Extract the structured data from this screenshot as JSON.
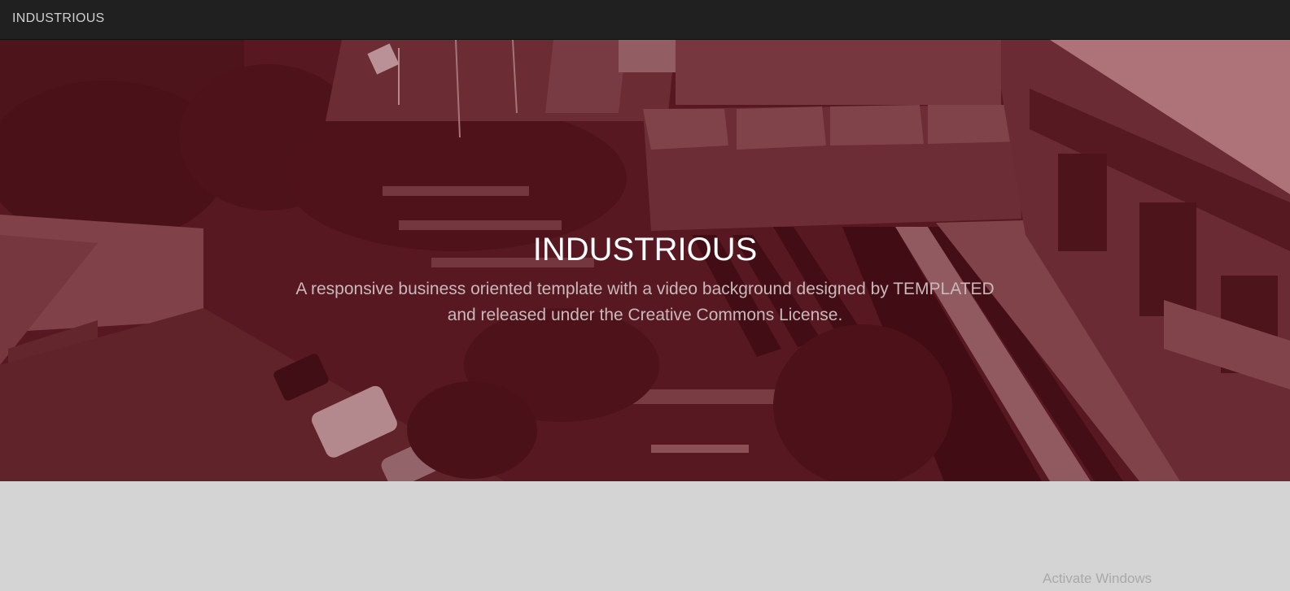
{
  "header": {
    "brand": "INDUSTRIOUS"
  },
  "hero": {
    "title": "INDUSTRIOUS",
    "subtitle": "A responsive business oriented template with a video background designed by TEMPLATED and released under the Creative Commons License.",
    "overlay_color": "#6e1420"
  },
  "watermark": {
    "text": "Activate Windows"
  },
  "colors": {
    "topbar": "#202020",
    "page_background": "#d4d4d4",
    "hero_tint": "#4a1a20"
  }
}
